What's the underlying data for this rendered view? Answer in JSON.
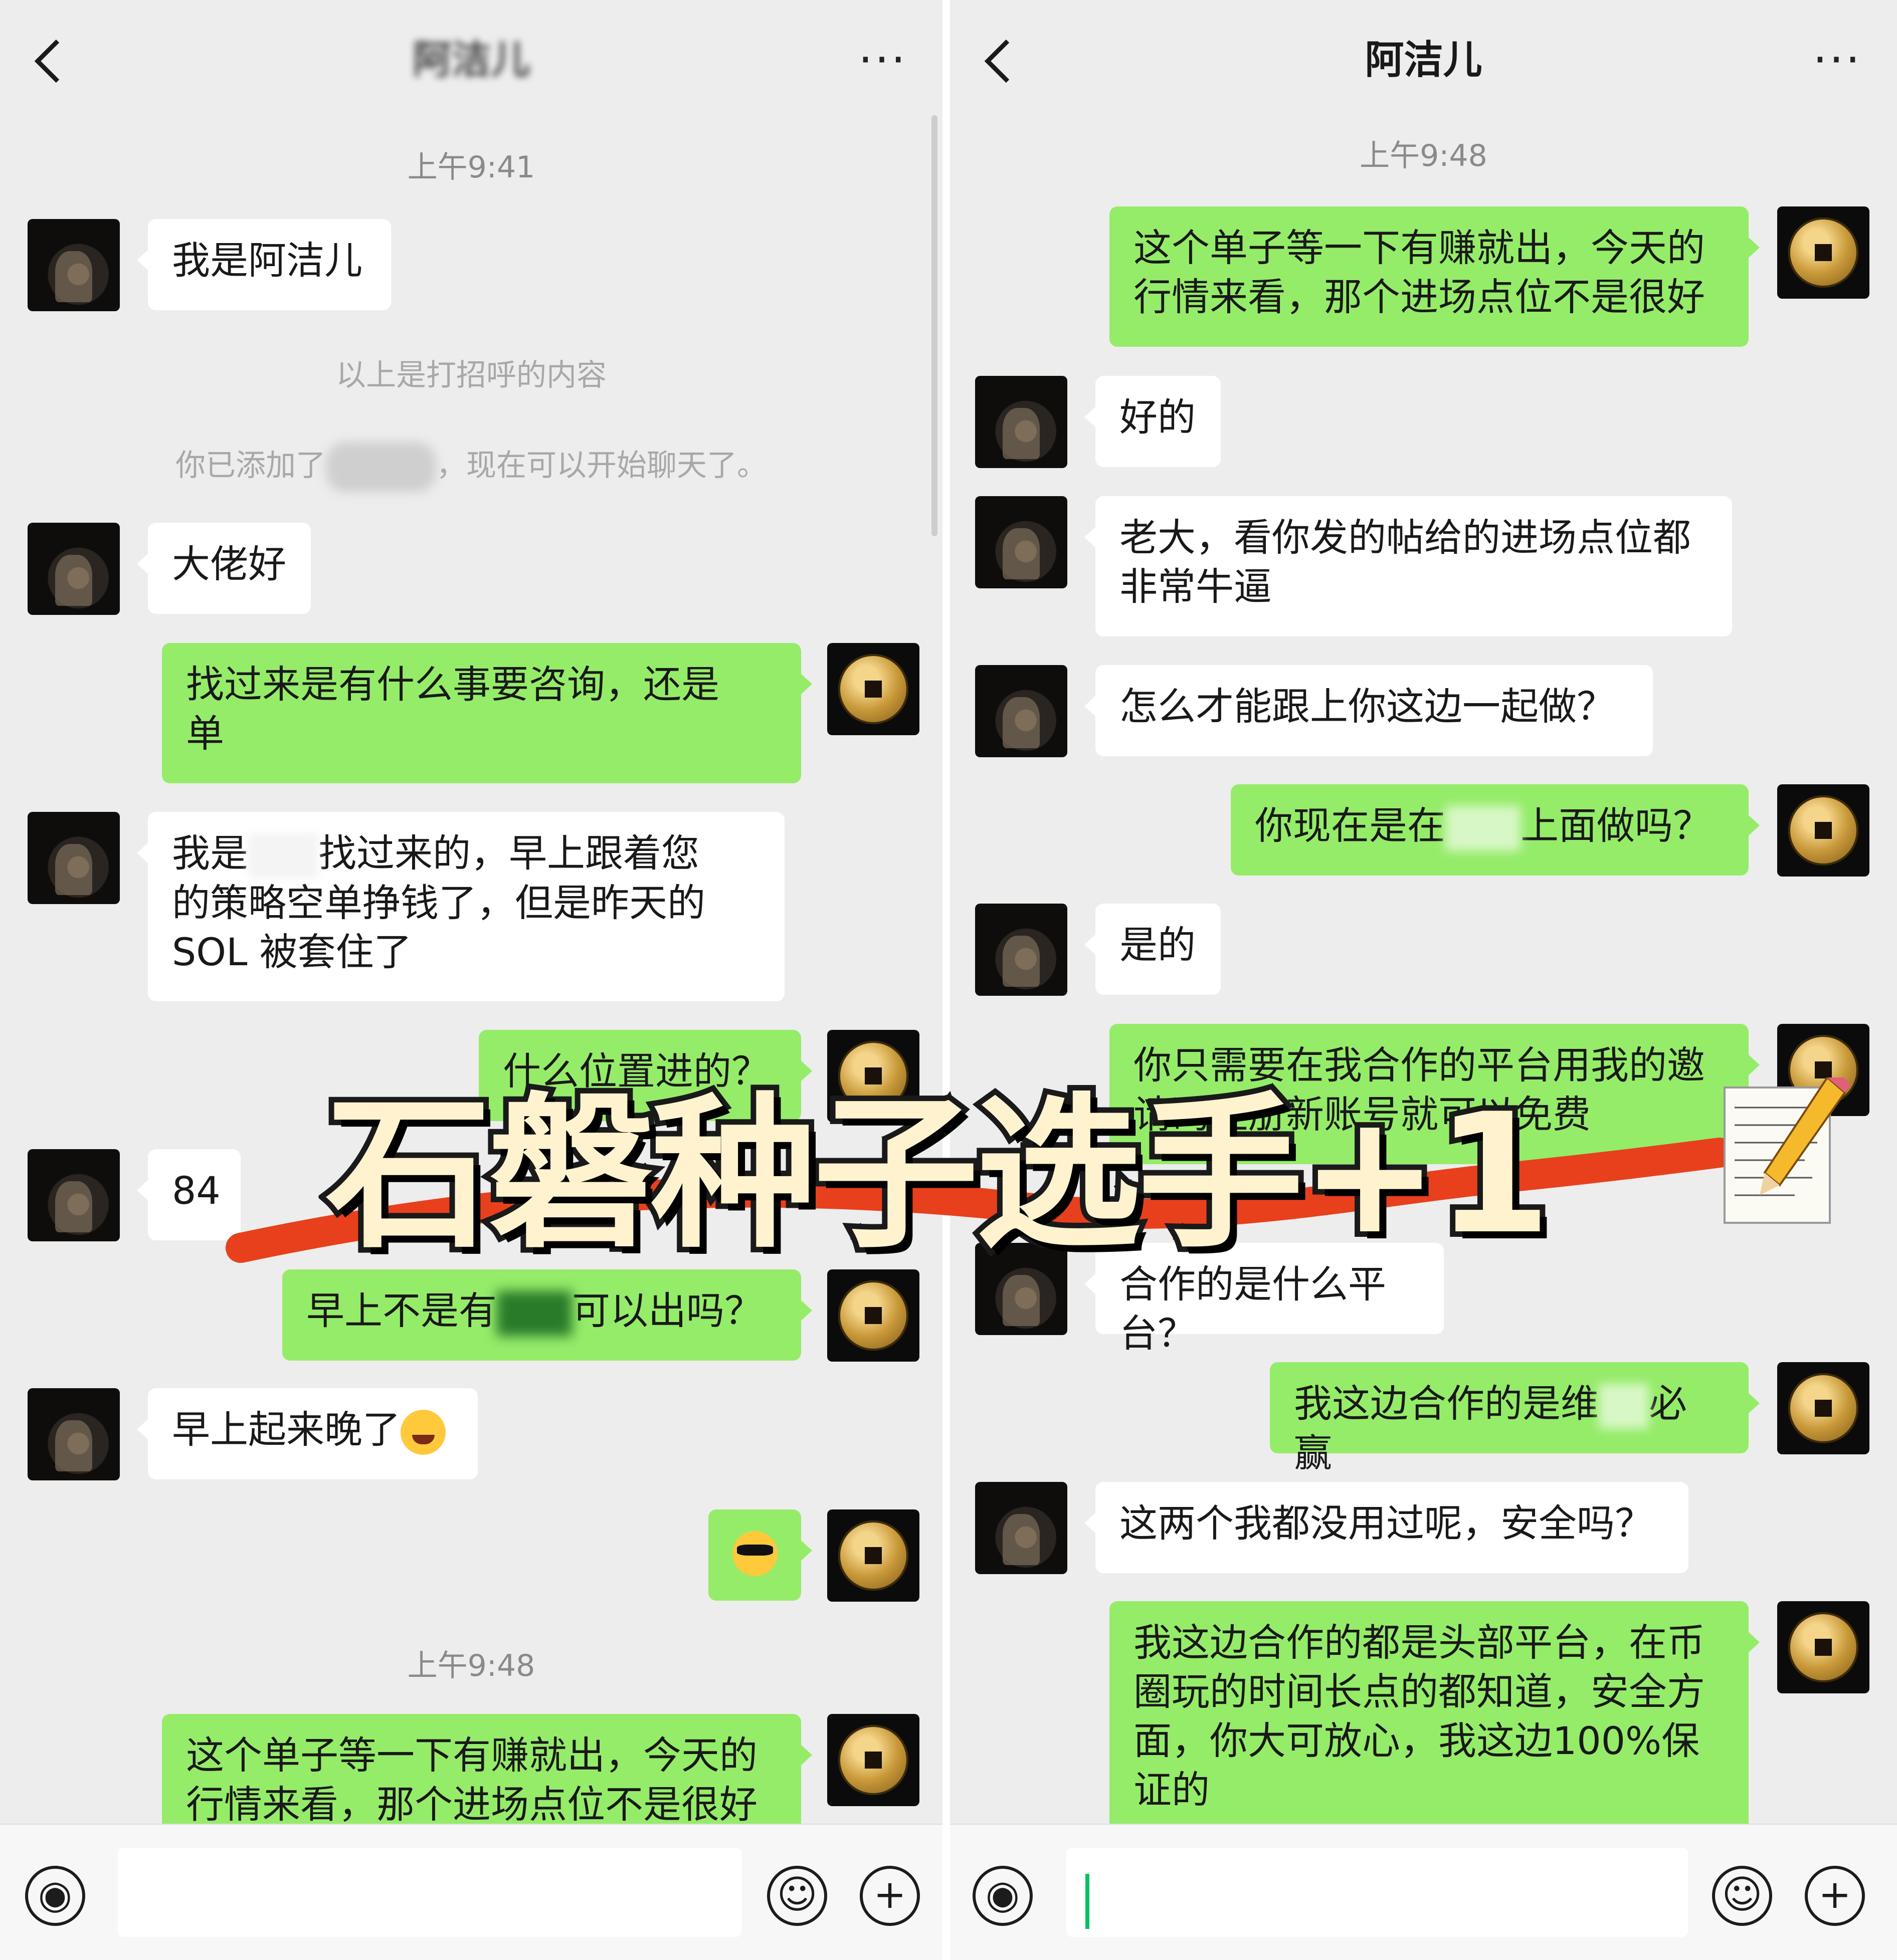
{
  "left": {
    "header": {
      "title": "阿洁儿",
      "more": "···"
    },
    "messages": {
      "time_1": "上午9:41",
      "m1": "我是阿洁儿",
      "sys_1": "以上是打招呼的内容",
      "sys_2a": "你已添加了",
      "sys_2b": "，现在可以开始聊天了。",
      "m2": "大佬好",
      "m3a": "找过来是有什么事要咨询，还是",
      "m3b": "单",
      "m4a": "我是",
      "m4b": "找过来的，早上跟着您",
      "m4c": "的策略空单挣钱了，但是昨天的",
      "m4d": "SOL 被套住了",
      "m5": "什么位置进的？",
      "m6": "84",
      "m7a": "早上不是有",
      "m7b": "可以出吗？",
      "m8": "早上起来晚了",
      "time_2": "上午9:48",
      "m10a": "这个单子等一下有赚就出，今天的",
      "m10b": "行情来看，那个进场点位不是很好"
    }
  },
  "right": {
    "header": {
      "title": "阿洁儿",
      "more": "···"
    },
    "messages": {
      "time_1": "上午9:48",
      "r1a": "这个单子等一下有赚就出，今天的",
      "r1b": "行情来看，那个进场点位不是很好",
      "r2": "好的",
      "r3a": "老大，看你发的帖给的进场点位都",
      "r3b": "非常牛逼",
      "r4": "怎么才能跟上你这边一起做？",
      "r5a": "你现在是在",
      "r5b": "上面做吗？",
      "r6": "是的",
      "r7a": "你只需要在我合作的平台用我的邀",
      "r7b": "请码注册新账号就可以免费",
      "r8": "合作的是什么平台？",
      "r9a": "我这边合作的是维",
      "r9b": "必赢",
      "r10": "这两个我都没用过呢，安全吗？",
      "r11a": "我这边合作的都是头部平台，在币",
      "r11b": "圈玩的时间长点的都知道，安全方",
      "r11c": "面，你大可放心，我这边100%保",
      "r11d": "证的"
    }
  },
  "overlay": {
    "caption": "石磐种子选手+1"
  },
  "colors": {
    "bubble_me": "#95ec69",
    "bubble_other": "#ffffff",
    "background": "#ededed",
    "accent_stroke": "#e8401c"
  },
  "icons": [
    "back-arrow-icon",
    "more-dots-icon",
    "voice-icon",
    "emoji-icon",
    "plus-icon",
    "coin-avatar-icon",
    "memo-pencil-icon"
  ]
}
